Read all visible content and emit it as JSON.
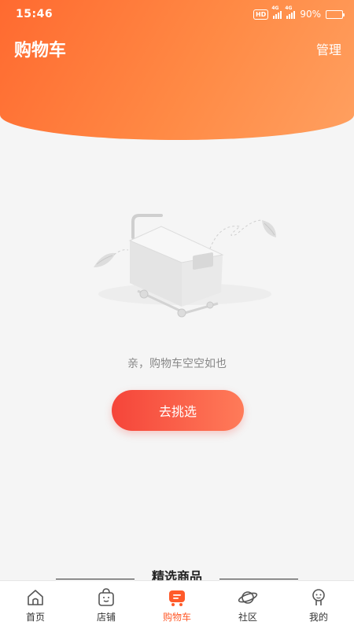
{
  "status_bar": {
    "time": "15:46",
    "hd": "HD",
    "network1": "4G",
    "network2": "4G",
    "battery": "90%",
    "battery_level": 0.9
  },
  "header": {
    "title": "购物车",
    "manage_label": "管理"
  },
  "empty_state": {
    "message": "亲，购物车空空如也",
    "button_label": "去挑选"
  },
  "featured": {
    "title": "精选商品"
  },
  "tabbar": {
    "active": "购物车",
    "active_color": "#ff5a2a",
    "items": [
      {
        "label": "首页",
        "icon": "home-icon"
      },
      {
        "label": "店铺",
        "icon": "store-bag-icon"
      },
      {
        "label": "购物车",
        "icon": "cart-icon"
      },
      {
        "label": "社区",
        "icon": "planet-icon"
      },
      {
        "label": "我的",
        "icon": "profile-icon"
      }
    ]
  },
  "colors": {
    "header_gradient_start": "#ff6a30",
    "header_gradient_end": "#ffa060",
    "button_start": "#f5453a",
    "button_end": "#ff7b59"
  }
}
